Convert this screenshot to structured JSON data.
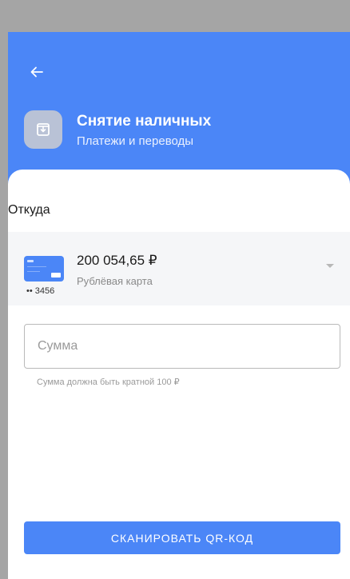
{
  "header": {
    "title": "Снятие наличных",
    "subtitle": "Платежи и переводы",
    "back_icon": "arrow-left-icon",
    "operation_icon": "cash-withdraw-icon",
    "accent_color": "#4b86f7"
  },
  "form": {
    "from_label": "Откуда",
    "card": {
      "balance": "200 054,65 ₽",
      "type": "Рублёвая карта",
      "last_digits": "•• 3456"
    },
    "amount_placeholder": "Сумма",
    "amount_value": "",
    "hint": "Сумма должна быть кратной 100 ₽",
    "scan_button": "СКАНИРОВАТЬ QR-КОД"
  }
}
